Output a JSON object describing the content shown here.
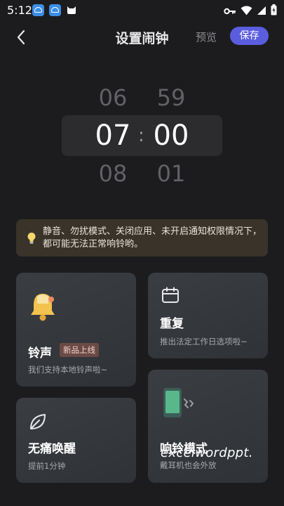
{
  "status_bar": {
    "time": "5:12"
  },
  "header": {
    "title": "设置闹钟",
    "preview_label": "预览",
    "save_label": "保存"
  },
  "time_picker": {
    "hour_prev": "06",
    "hour_selected": "07",
    "hour_next": "08",
    "minute_prev": "59",
    "minute_selected": "00",
    "minute_next": "01",
    "separator": ":"
  },
  "notice": {
    "text": "静音、勿扰模式、关闭应用、未开启通知权限情况下，都可能无法正常响铃哟。"
  },
  "cards": {
    "ringtone": {
      "title": "铃声",
      "badge": "新品上线",
      "subtitle": "我们支持本地铃声啦~"
    },
    "repeat": {
      "title": "重复",
      "subtitle": "推出法定工作日选项啦~"
    },
    "gentle_wake": {
      "title": "无痛唤醒",
      "subtitle": "提前1分钟"
    },
    "ring_mode": {
      "title": "响铃模式",
      "subtitle": "戴耳机也会外放"
    }
  },
  "watermark": "excelwordppt.",
  "colors": {
    "accent": "#5b5ddf",
    "background": "#1c1c1e",
    "card": "#33363b",
    "notice_bg": "#3a332a"
  }
}
